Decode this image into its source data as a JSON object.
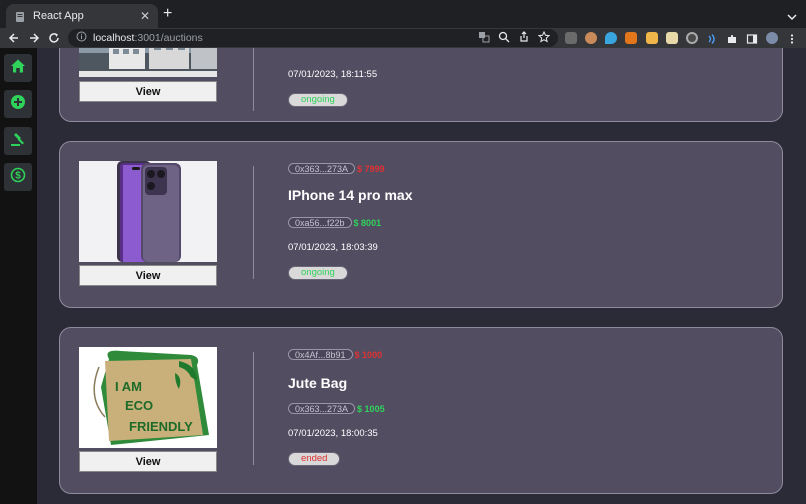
{
  "browser": {
    "tab_title": "React App",
    "url_host": "localhost",
    "url_path": ":3001/auctions"
  },
  "sidebar": {
    "items": [
      {
        "icon": "home-icon"
      },
      {
        "icon": "add-circle-icon"
      },
      {
        "icon": "gavel-icon"
      },
      {
        "icon": "dollar-coin-icon"
      }
    ]
  },
  "auctions": [
    {
      "date": "07/01/2023, 18:11:55",
      "status": "ongoing",
      "status_color": "#2fd35a",
      "view_label": "View"
    },
    {
      "seller": "0x363...273A",
      "start_price": "$ 7999",
      "title": "IPhone 14 pro max",
      "bidder": "0xa56...f22b",
      "bid_price": "$ 8001",
      "date": "07/01/2023, 18:03:39",
      "status": "ongoing",
      "status_color": "#2fd35a",
      "view_label": "View"
    },
    {
      "seller": "0x4Af...8b91",
      "start_price": "$ 1000",
      "title": "Jute Bag",
      "bidder": "0x363...273A",
      "bid_price": "$ 1005",
      "date": "07/01/2023, 18:00:35",
      "status": "ended",
      "status_color": "#e03232",
      "view_label": "View",
      "image_text": [
        "I AM",
        "ECO",
        "FRIENDLY"
      ]
    }
  ]
}
